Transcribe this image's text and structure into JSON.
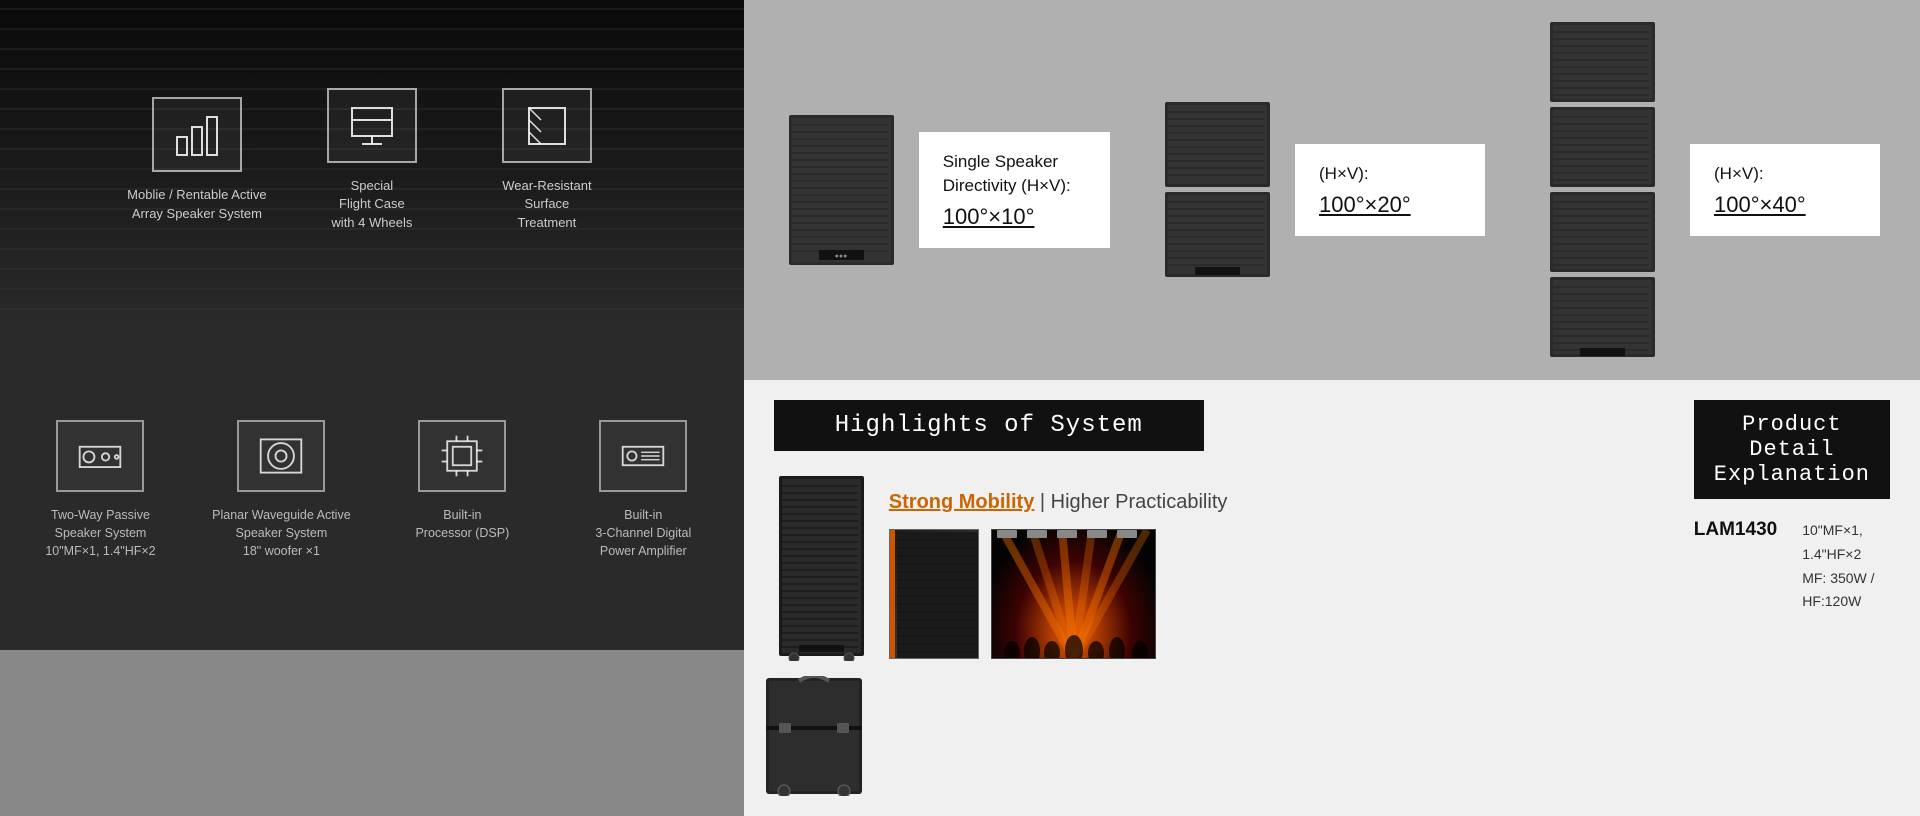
{
  "left": {
    "top_icons": [
      {
        "id": "mobile-icon",
        "icon_type": "bar-chart",
        "label": "Moblie / Rentable\nActive Array\nSpeaker System"
      },
      {
        "id": "flight-case-icon",
        "icon_type": "monitor",
        "label": "Special\nFlight Case\nwith 4 Wheels"
      },
      {
        "id": "surface-icon",
        "icon_type": "square",
        "label": "Wear-Resistant\nSurface\nTreatment"
      }
    ],
    "bottom_icons": [
      {
        "id": "two-way-icon",
        "icon_type": "speaker",
        "label": "Two-Way Passive\nSpeaker System\n10\"MF×1, 1.4\"HF×2"
      },
      {
        "id": "planar-icon",
        "icon_type": "circle",
        "label": "Planar Waveguide Active\nSpeaker System\n18\" woofer ×1"
      },
      {
        "id": "dsp-icon",
        "icon_type": "processor",
        "label": "Built-in\nProcessor (DSP)"
      },
      {
        "id": "amplifier-icon",
        "icon_type": "amplifier",
        "label": "Built-in\n3-Channel Digital\nPower Amplifier"
      }
    ]
  },
  "top_right": {
    "card1": {
      "title": "Single Speaker\nDirectivity (H×V):",
      "value": "100°×10°"
    },
    "card2": {
      "title": "(H×V):",
      "value": "100°×20°"
    },
    "card3": {
      "title": "(H×V):",
      "value": "100°×40°"
    }
  },
  "bottom_right_left": {
    "section_title": "Highlights of System",
    "mobility_text": "Strong Mobility",
    "mobility_separator": " | Higher Practicability"
  },
  "bottom_right_right": {
    "section_title": "Product Detail Explanation",
    "model": "LAM1430",
    "specs": "10\"MF×1, 1.4\"HF×2\nMF: 350W / HF:120W"
  }
}
